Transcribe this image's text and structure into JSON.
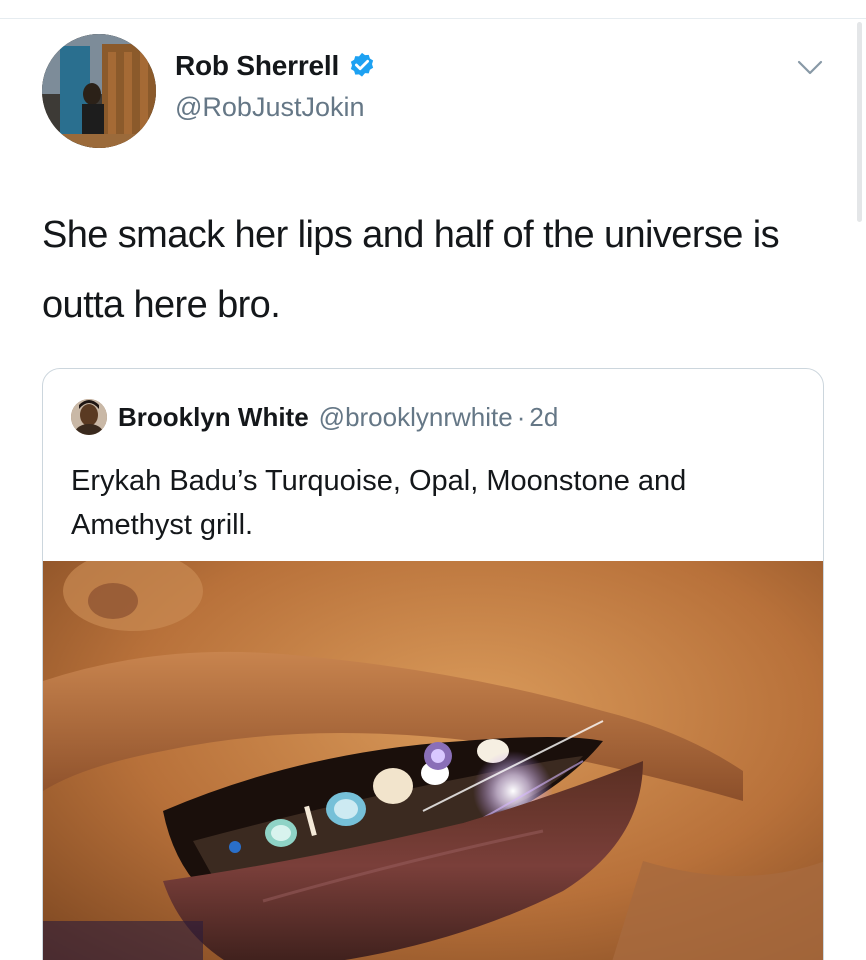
{
  "tweet": {
    "author": {
      "name": "Rob Sherrell",
      "handle": "@RobJustJokin",
      "verified": true,
      "avatar_icon": "profile-photo"
    },
    "text": "She smack her lips and half of the universe is outta here bro.",
    "menu_icon": "chevron-down-icon"
  },
  "quoted_tweet": {
    "author": {
      "name": "Brooklyn White",
      "handle": "@brooklynrwhite",
      "avatar_icon": "profile-photo"
    },
    "separator": "·",
    "time": "2d",
    "text": "Erykah Badu’s Turquoise, Opal, Moonstone and Amethyst grill.",
    "media_icon": "photo-lips-grill"
  },
  "colors": {
    "verified_blue": "#1da1f2",
    "text_primary": "#14171a",
    "text_secondary": "#657786",
    "border": "#ccd6dd"
  }
}
